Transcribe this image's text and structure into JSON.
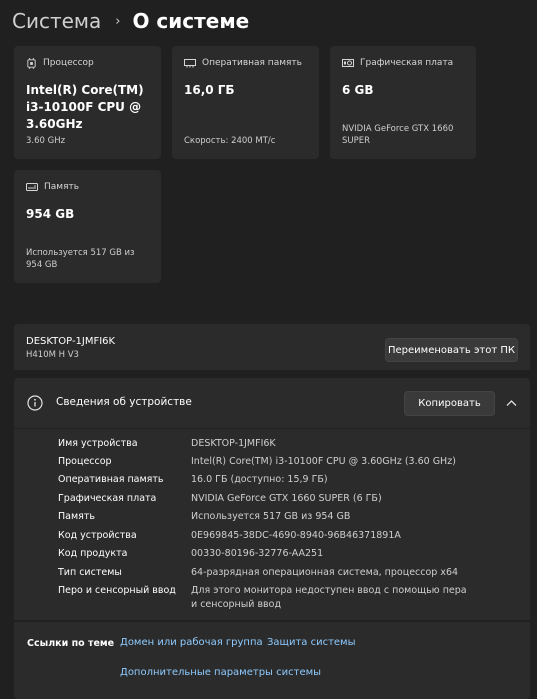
{
  "breadcrumb": {
    "parent": "Система",
    "separator": "›",
    "current": "О системе"
  },
  "cards": {
    "cpu": {
      "label": "Процессор",
      "value": "Intel(R) Core(TM) i3-10100F CPU @ 3.60GHz",
      "sub": "3.60 GHz"
    },
    "ram": {
      "label": "Оперативная память",
      "value": "16,0 ГБ",
      "sub": "Скорость: 2400 МТ/с"
    },
    "gpu": {
      "label": "Графическая плата",
      "value": "6 GB",
      "sub": "NVIDIA GeForce GTX 1660 SUPER"
    },
    "storage": {
      "label": "Память",
      "value": "954 GB",
      "sub": "Используется 517 GB из 954 GB"
    }
  },
  "device": {
    "name": "DESKTOP-1JMFI6K",
    "model": "H410M H V3",
    "rename_label": "Переименовать этот ПК"
  },
  "specs": {
    "title": "Сведения об устройстве",
    "copy_label": "Копировать",
    "rows": [
      {
        "key": "Имя устройства",
        "value": "DESKTOP-1JMFI6K"
      },
      {
        "key": "Процессор",
        "value": "Intel(R) Core(TM) i3-10100F CPU @ 3.60GHz   (3.60 GHz)"
      },
      {
        "key": "Оперативная память",
        "value": "16.0 ГБ (доступно: 15,9 ГБ)"
      },
      {
        "key": "Графическая плата",
        "value": "NVIDIA GeForce GTX 1660 SUPER (6 ГБ)"
      },
      {
        "key": "Память",
        "value": "Используется 517 GB из 954 GB"
      },
      {
        "key": "Код устройства",
        "value": "0E969845-38DC-4690-8940-96B46371891A"
      },
      {
        "key": "Код продукта",
        "value": "00330-80196-32776-AA251"
      },
      {
        "key": "Тип системы",
        "value": "64-разрядная операционная система, процессор x64"
      },
      {
        "key": "Перо и сенсорный ввод",
        "value": "Для этого монитора недоступен ввод с помощью пера и сенсорный ввод"
      }
    ]
  },
  "related": {
    "title": "Ссылки по теме",
    "domain": "Домен или рабочая группа",
    "protection": "Защита системы",
    "advanced": "Дополнительные параметры системы"
  }
}
